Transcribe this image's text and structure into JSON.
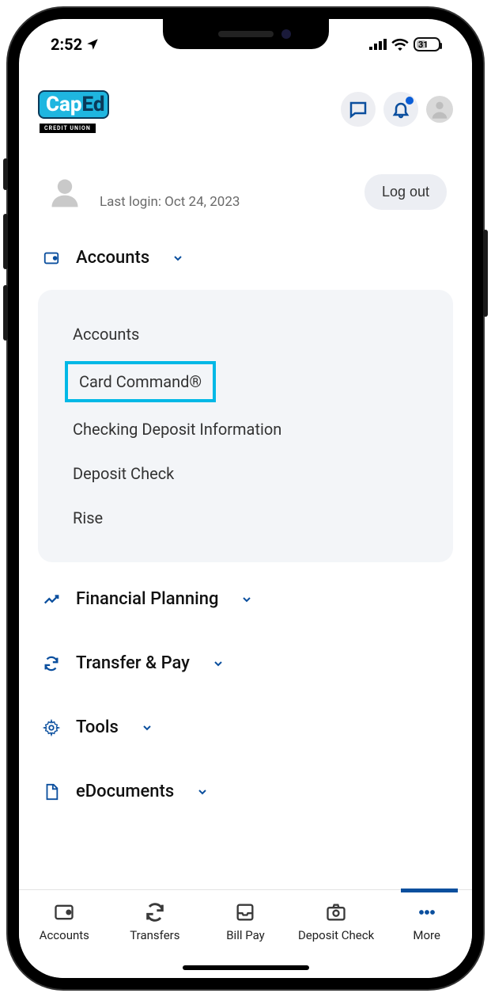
{
  "status": {
    "time": "2:52",
    "battery": "31"
  },
  "logo": {
    "text1": "Cap",
    "text2": "Ed",
    "sub": "CREDIT UNION"
  },
  "user": {
    "last_login": "Last login: Oct 24, 2023",
    "logout": "Log out"
  },
  "menu": {
    "accounts": {
      "label": "Accounts",
      "items": [
        "Accounts",
        "Card Command®",
        "Checking Deposit Information",
        "Deposit Check",
        "Rise"
      ]
    },
    "financial": {
      "label": "Financial Planning"
    },
    "transfer": {
      "label": "Transfer & Pay"
    },
    "tools": {
      "label": "Tools"
    },
    "edocs": {
      "label": "eDocuments"
    }
  },
  "nav": {
    "accounts": "Accounts",
    "transfers": "Transfers",
    "billpay": "Bill Pay",
    "deposit": "Deposit Check",
    "more": "More"
  }
}
